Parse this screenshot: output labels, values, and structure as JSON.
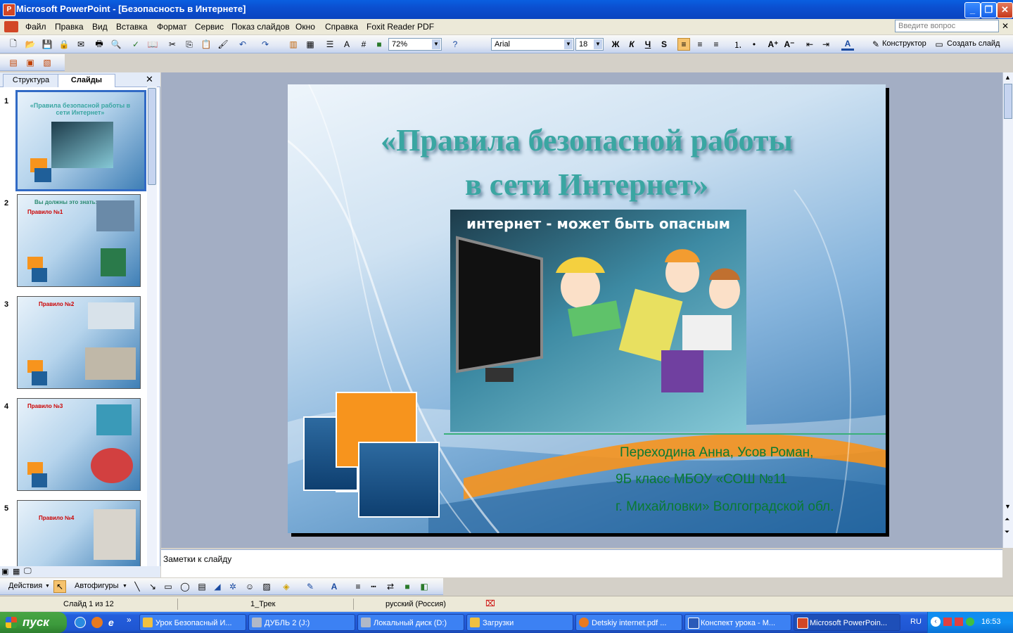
{
  "window": {
    "app_icon": "powerpoint-app-icon",
    "title": "Microsoft PowerPoint - [Безопасность в Интернете]"
  },
  "menu": {
    "items": [
      "Файл",
      "Правка",
      "Вид",
      "Вставка",
      "Формат",
      "Сервис",
      "Показ слайдов",
      "Окно",
      "Справка",
      "Foxit Reader PDF"
    ],
    "ask_placeholder": "Введите вопрос"
  },
  "toolbar": {
    "zoom": "72%",
    "font_name": "Arial",
    "font_size": "18",
    "bold": "Ж",
    "italic": "К",
    "underline": "Ч",
    "shadow": "S",
    "designer_label": "Конструктор",
    "new_slide_label": "Создать слайд"
  },
  "left_pane": {
    "tabs": [
      "Структура",
      "Слайды"
    ],
    "selected_tab": "Слайды",
    "thumbnails": [
      {
        "num": "1",
        "title": "«Правила безопасной работы в сети Интернет»"
      },
      {
        "num": "2",
        "title": "Вы должны это знать:",
        "subtitle": "Правило №1"
      },
      {
        "num": "3",
        "title": "Правило №2"
      },
      {
        "num": "4",
        "title": "Правило №3"
      },
      {
        "num": "5",
        "title": "Правило №4"
      }
    ]
  },
  "slide": {
    "title_line1": "«Правила безопасной работы",
    "title_line2": "в сети Интернет»",
    "picture_caption": "интернет - может быть опасным",
    "authors": [
      "Переходина Анна, Усов Роман,",
      "9Б класс МБОУ «СОШ №11",
      "г. Михайловки» Волгоградской обл."
    ],
    "colors": {
      "title": "#3aa6a2",
      "authors": "#0a7a32",
      "orange": "#f7941d",
      "blue": "#1f5f99"
    }
  },
  "notes": {
    "placeholder": "Заметки к слайду"
  },
  "drawing_toolbar": {
    "actions_label": "Действия",
    "autoshapes_label": "Автофигуры"
  },
  "status": {
    "slide_info": "Слайд 1 из 12",
    "design": "1_Трек",
    "language": "русский (Россия)"
  },
  "taskbar": {
    "start_label": "пуск",
    "tasks": [
      {
        "label": "Урок Безопасный И...",
        "icon": "folder-icon"
      },
      {
        "label": "ДУБЛЬ 2 (J:)",
        "icon": "drive-icon"
      },
      {
        "label": "Локальный диск (D:)",
        "icon": "drive-icon"
      },
      {
        "label": "Загрузки",
        "icon": "folder-icon"
      },
      {
        "label": "Detskiy internet.pdf ...",
        "icon": "firefox-icon"
      },
      {
        "label": "Конспект урока - М...",
        "icon": "word-icon"
      },
      {
        "label": "Microsoft PowerPoin...",
        "icon": "powerpoint-icon"
      }
    ],
    "language": "RU",
    "clock": "16:53"
  }
}
